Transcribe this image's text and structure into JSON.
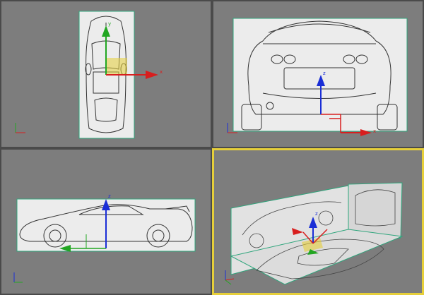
{
  "viewports": [
    {
      "id": "top",
      "active": false,
      "gizmo_labels": {
        "x": "x",
        "y": "y"
      }
    },
    {
      "id": "front",
      "active": false,
      "gizmo_labels": {
        "x": "x",
        "z": "z"
      }
    },
    {
      "id": "left",
      "active": false,
      "gizmo_labels": {
        "z": "z"
      }
    },
    {
      "id": "perspective",
      "active": true,
      "gizmo_labels": {
        "z": "z",
        "x": "x"
      }
    }
  ],
  "colors": {
    "viewport_bg": "#7d7d7d",
    "active_border": "#e6cf3a",
    "axis_x": "#d81e1e",
    "axis_y": "#22a622",
    "axis_z": "#1a2ed6",
    "plane_edge": "#2fa57c"
  },
  "icons": [
    "world-axis-tripod-icon",
    "transform-gizmo-icon"
  ]
}
